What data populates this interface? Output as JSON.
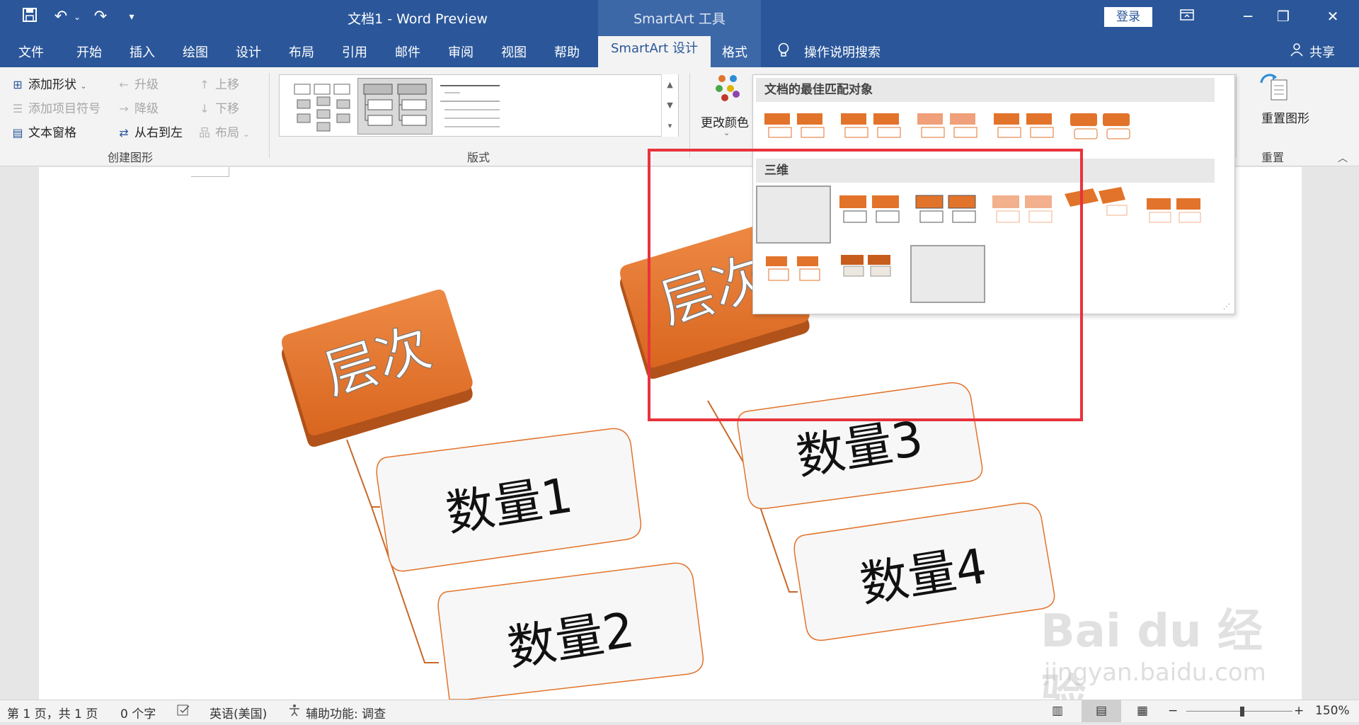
{
  "window": {
    "title": "文档1  -  Word Preview",
    "context_title": "SmartArt 工具",
    "login_label": "登录"
  },
  "tabs": [
    "文件",
    "开始",
    "插入",
    "绘图",
    "设计",
    "布局",
    "引用",
    "邮件",
    "审阅",
    "视图",
    "帮助",
    "SmartArt 设计",
    "格式"
  ],
  "active_tab": "SmartArt 设计",
  "tell_me": "操作说明搜索",
  "share_label": "共享",
  "ribbon": {
    "create_group": {
      "label": "创建图形",
      "add_shape": "添加形状",
      "add_bullet": "添加项目符号",
      "text_pane": "文本窗格",
      "promote": "升级",
      "demote": "降级",
      "right_to_left": "从右到左",
      "move_up": "上移",
      "move_down": "下移",
      "layout": "布局"
    },
    "layouts_group": {
      "label": "版式"
    },
    "change_colors": "更改颜色",
    "reset_group": {
      "label": "重置",
      "reset_graphic": "重置图形"
    }
  },
  "dropdown": {
    "section1": "文档的最佳匹配对象",
    "section2": "三维"
  },
  "smartart": {
    "heading1": "层次",
    "heading2": "层次",
    "items": [
      "数量1",
      "数量2",
      "数量3",
      "数量4"
    ]
  },
  "statusbar": {
    "page": "第 1 页，共 1 页",
    "words": "0 个字",
    "language": "英语(美国)",
    "accessibility": "辅助功能: 调查",
    "zoom": "150%"
  },
  "watermark": {
    "brand": "Bai du 经验",
    "url": "jingyan.baidu.com"
  },
  "colors": {
    "accent": "#2b579a",
    "orange": "#e2732a",
    "highlight": "#e8333c"
  }
}
